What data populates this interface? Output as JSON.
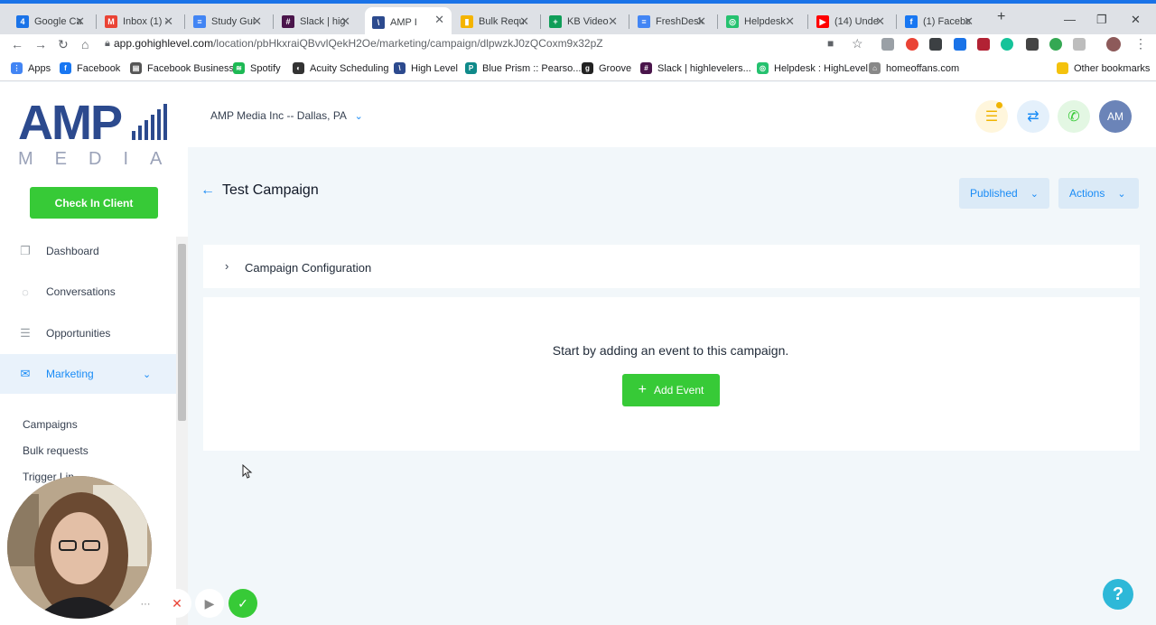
{
  "browser": {
    "tabs": [
      {
        "title": "Google Ca",
        "color": "#1a73e8",
        "glyph": "4"
      },
      {
        "title": "Inbox (1) -",
        "color": "#ea4335",
        "glyph": "M"
      },
      {
        "title": "Study Gui",
        "color": "#4285f4",
        "glyph": "≡"
      },
      {
        "title": "Slack | hig",
        "color": "#4a154b",
        "glyph": "#"
      },
      {
        "title": "AMP I",
        "color": "#2c4a8e",
        "glyph": "\\"
      },
      {
        "title": "Bulk Requ",
        "color": "#f4b400",
        "glyph": "▮"
      },
      {
        "title": "KB Video",
        "color": "#0f9d58",
        "glyph": "+"
      },
      {
        "title": "FreshDesk",
        "color": "#4285f4",
        "glyph": "≡"
      },
      {
        "title": "Helpdesk",
        "color": "#25c16f",
        "glyph": "◎"
      },
      {
        "title": "(14) Unde",
        "color": "#ff0000",
        "glyph": "▶"
      },
      {
        "title": "(1) Facebo",
        "color": "#1877f2",
        "glyph": "f"
      }
    ],
    "url_host": "app.gohighlevel.com",
    "url_path": "/location/pbHkxraiQBvvlQekH2Oe/marketing/campaign/dlpwzkJ0zQCoxm9x32pZ",
    "bookmarks": [
      {
        "label": "Apps",
        "color": "#4285f4",
        "glyph": "⋮"
      },
      {
        "label": "Facebook",
        "color": "#1877f2",
        "glyph": "f"
      },
      {
        "label": "Facebook Business",
        "color": "#555555",
        "glyph": "▤"
      },
      {
        "label": "Spotify",
        "color": "#1db954",
        "glyph": "≋"
      },
      {
        "label": "Acuity Scheduling",
        "color": "#333333",
        "glyph": "◐"
      },
      {
        "label": "High Level",
        "color": "#2c4a8e",
        "glyph": "\\"
      },
      {
        "label": "Blue Prism :: Pearso...",
        "color": "#0f8a8a",
        "glyph": "P"
      },
      {
        "label": "Groove",
        "color": "#222222",
        "glyph": "g"
      },
      {
        "label": "Slack | highlevelers...",
        "color": "#4a154b",
        "glyph": "#"
      },
      {
        "label": "Helpdesk : HighLevel",
        "color": "#25c16f",
        "glyph": "◎"
      },
      {
        "label": "homeoffans.com",
        "color": "#888888",
        "glyph": "⌂"
      }
    ],
    "other_bookmarks": "Other bookmarks"
  },
  "logo": {
    "amp": "AMP",
    "media": "MEDIA"
  },
  "sidebar": {
    "checkin_label": "Check In Client",
    "items": [
      {
        "label": "Dashboard",
        "icon": "dashboard-icon"
      },
      {
        "label": "Conversations",
        "icon": "chat-icon"
      },
      {
        "label": "Opportunities",
        "icon": "opportunities-icon"
      },
      {
        "label": "Marketing",
        "icon": "mail-icon"
      }
    ],
    "subitems": [
      "Campaigns",
      "Bulk requests",
      "Trigger Lin"
    ]
  },
  "header": {
    "location": "AMP Media Inc -- Dallas, PA",
    "avatar": "AM"
  },
  "campaign": {
    "title": "Test Campaign",
    "status": "Published",
    "actions": "Actions",
    "config_label": "Campaign Configuration",
    "empty_text": "Start by adding an event to this campaign.",
    "add_event": "Add Event"
  },
  "colors": {
    "accent": "#188bf6",
    "green": "#37ca37",
    "brand": "#2c4a8e"
  }
}
